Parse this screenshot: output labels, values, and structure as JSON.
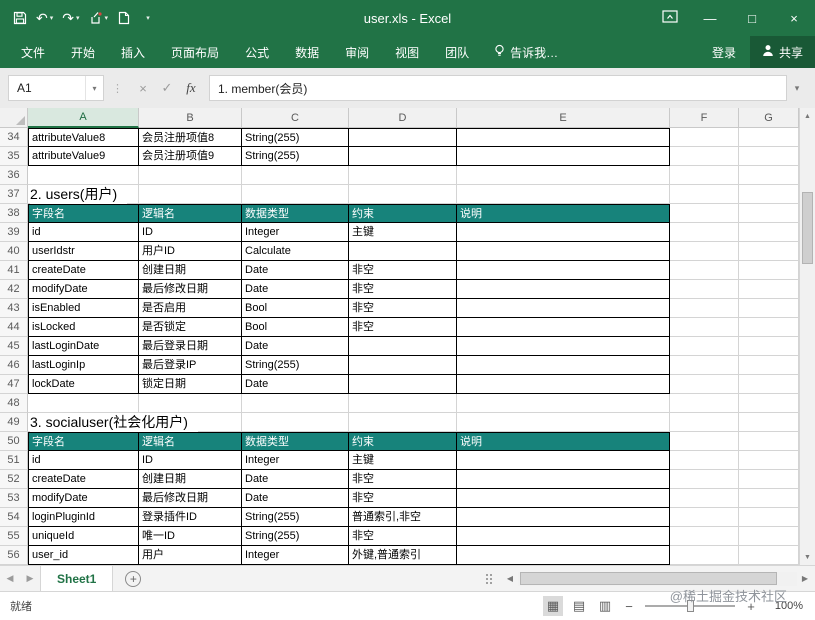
{
  "colors": {
    "brand_green": "#217346",
    "table_header_teal": "#17837B"
  },
  "window": {
    "title": "user.xls - Excel",
    "controls": {
      "minimize": "—",
      "maximize": "□",
      "close": "×"
    }
  },
  "quick_access": {
    "undo": "↶",
    "redo": "↷",
    "dropdown": "▾"
  },
  "ribbon": {
    "tabs": [
      "文件",
      "开始",
      "插入",
      "页面布局",
      "公式",
      "数据",
      "审阅",
      "视图",
      "团队"
    ],
    "tell_me": "告诉我…",
    "sign_in": "登录",
    "share": "共享"
  },
  "formula_bar": {
    "name_box": "A1",
    "dropdown": "▾",
    "cancel": "×",
    "enter": "✓",
    "fx": "fx",
    "formula": "1. member(会员)"
  },
  "grid": {
    "columns": [
      "A",
      "B",
      "C",
      "D",
      "E",
      "F",
      "G"
    ],
    "selected_column": "A",
    "rows": [
      {
        "num": 34,
        "type": "data",
        "cells": [
          "attributeValue8",
          "会员注册项值8",
          "String(255)",
          "",
          ""
        ]
      },
      {
        "num": 35,
        "type": "data",
        "cells": [
          "attributeValue9",
          "会员注册项值9",
          "String(255)",
          "",
          ""
        ]
      },
      {
        "num": 36,
        "type": "empty"
      },
      {
        "num": 37,
        "type": "section",
        "label": "2. users(用户)"
      },
      {
        "num": 38,
        "type": "header",
        "cells": [
          "字段名",
          "逻辑名",
          "数据类型",
          "约束",
          "说明"
        ]
      },
      {
        "num": 39,
        "type": "data",
        "cells": [
          "id",
          "ID",
          "Integer",
          "主键",
          ""
        ]
      },
      {
        "num": 40,
        "type": "data",
        "cells": [
          "userIdstr",
          "用户ID",
          "Calculate",
          "",
          ""
        ]
      },
      {
        "num": 41,
        "type": "data",
        "cells": [
          "createDate",
          "创建日期",
          "Date",
          "非空",
          ""
        ]
      },
      {
        "num": 42,
        "type": "data",
        "cells": [
          "modifyDate",
          "最后修改日期",
          "Date",
          "非空",
          ""
        ]
      },
      {
        "num": 43,
        "type": "data",
        "cells": [
          "isEnabled",
          "是否启用",
          "Bool",
          "非空",
          ""
        ]
      },
      {
        "num": 44,
        "type": "data",
        "cells": [
          "isLocked",
          "是否锁定",
          "Bool",
          "非空",
          ""
        ]
      },
      {
        "num": 45,
        "type": "data",
        "cells": [
          "lastLoginDate",
          "最后登录日期",
          "Date",
          "",
          ""
        ]
      },
      {
        "num": 46,
        "type": "data",
        "cells": [
          "lastLoginIp",
          "最后登录IP",
          "String(255)",
          "",
          ""
        ]
      },
      {
        "num": 47,
        "type": "data",
        "cells": [
          "lockDate",
          "锁定日期",
          "Date",
          "",
          ""
        ]
      },
      {
        "num": 48,
        "type": "empty"
      },
      {
        "num": 49,
        "type": "section",
        "label": "3. socialuser(社会化用户)"
      },
      {
        "num": 50,
        "type": "header",
        "cells": [
          "字段名",
          "逻辑名",
          "数据类型",
          "约束",
          "说明"
        ]
      },
      {
        "num": 51,
        "type": "data",
        "cells": [
          "id",
          "ID",
          "Integer",
          "主键",
          ""
        ]
      },
      {
        "num": 52,
        "type": "data",
        "cells": [
          "createDate",
          "创建日期",
          "Date",
          "非空",
          ""
        ]
      },
      {
        "num": 53,
        "type": "data",
        "cells": [
          "modifyDate",
          "最后修改日期",
          "Date",
          "非空",
          ""
        ]
      },
      {
        "num": 54,
        "type": "data",
        "cells": [
          "loginPluginId",
          "登录插件ID",
          "String(255)",
          "普通索引,非空",
          ""
        ]
      },
      {
        "num": 55,
        "type": "data",
        "cells": [
          "uniqueId",
          "唯一ID",
          "String(255)",
          "非空",
          ""
        ]
      },
      {
        "num": 56,
        "type": "data",
        "cells": [
          "user_id",
          "用户",
          "Integer",
          "外键,普通索引",
          ""
        ]
      }
    ]
  },
  "sheet_bar": {
    "sheets": [
      {
        "name": "Sheet1",
        "active": true
      }
    ],
    "prev_arrow": "◀",
    "next_arrow": "▶",
    "add_sheet": "+"
  },
  "status_bar": {
    "status": "就绪",
    "zoom": "100%",
    "zoom_out": "−",
    "zoom_in": "+",
    "view_icons": [
      {
        "name": "normal-view-icon",
        "glyph": "▦"
      },
      {
        "name": "page-layout-view-icon",
        "glyph": "▤"
      },
      {
        "name": "page-break-view-icon",
        "glyph": "▥"
      }
    ]
  },
  "watermark": "@稀土掘金技术社区"
}
